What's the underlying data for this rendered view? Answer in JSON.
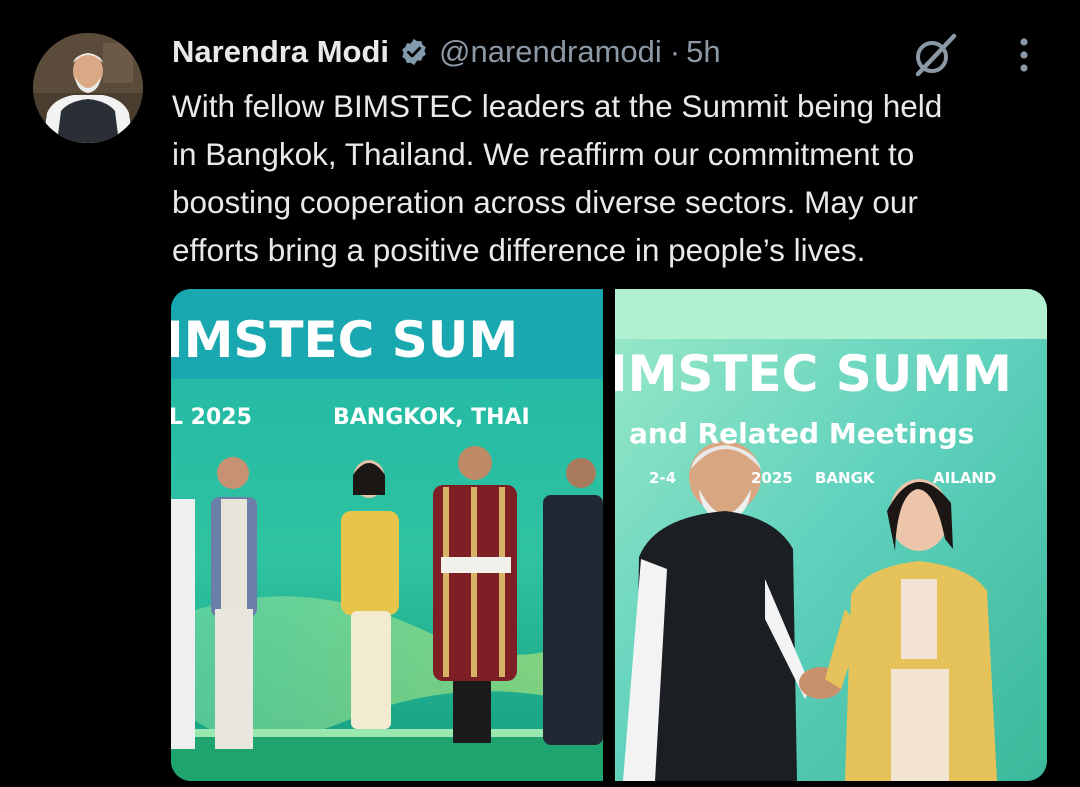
{
  "post": {
    "author_name": "Narendra Modi",
    "handle": "@narendramodi",
    "separator": "·",
    "time": "5h",
    "text": "With fellow BIMSTEC leaders at the Summit being held\nin Bangkok, Thailand. We reaffirm our commitment to\nboosting cooperation across diverse sectors. May our\nefforts bring a positive difference in people’s lives."
  },
  "icons": {
    "verified": "verified-badge-icon",
    "grok": "grok-icon",
    "more": "more-options-icon"
  },
  "media": {
    "left_photo": {
      "banner_title": "IMSTEC SUM",
      "banner_sub_date": "L 2025",
      "banner_sub_city": "BANGKOK, THAI"
    },
    "right_photo": {
      "banner_title": "IMSTEC SUMM",
      "banner_sub": "and Related Meetings",
      "banner_date": "2-4",
      "banner_year": "2025",
      "banner_city": "BANGK",
      "banner_country": "AILAND"
    }
  },
  "colors": {
    "background": "#000000",
    "text_primary": "#e7e9ea",
    "text_secondary": "#8b98a5",
    "verified_gray": "#829aab",
    "banner_teal": "#16b3a4",
    "banner_green": "#2ec27e"
  }
}
